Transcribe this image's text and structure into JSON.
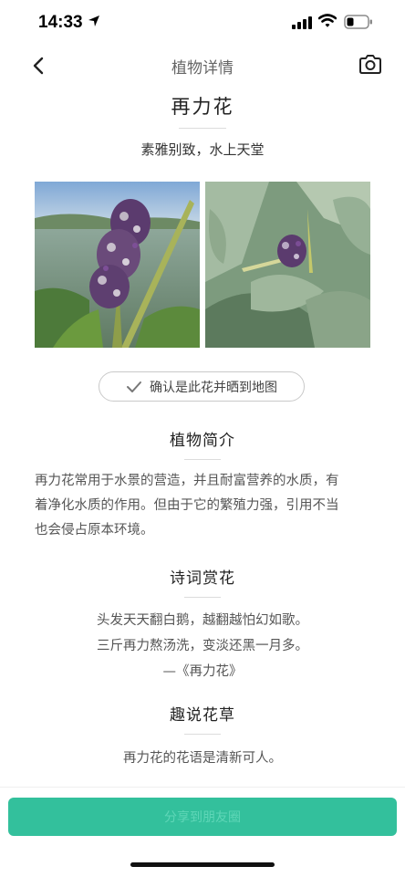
{
  "status_bar": {
    "time": "14:33",
    "icons": [
      "location-arrow-icon",
      "cellular-signal-icon",
      "wifi-icon",
      "battery-icon"
    ]
  },
  "nav": {
    "title": "植物详情",
    "back_icon": "chevron-left-icon",
    "camera_icon": "camera-icon"
  },
  "plant": {
    "name": "再力花",
    "slogan": "素雅别致，水上天堂",
    "photos": [
      "plant-photo-closeup",
      "plant-photo-leaves"
    ]
  },
  "confirm_button": {
    "label": "确认是此花并晒到地图",
    "icon": "checkmark-icon"
  },
  "intro": {
    "title": "植物简介",
    "lines": [
      "再力花常用于水景的营造，并且耐富营养的水质，有",
      "着净化水质的作用。但由于它的繁殖力强，引用不当",
      "也会侵占原本环境。"
    ]
  },
  "poem": {
    "title": "诗词赏花",
    "lines": [
      "头发天天翻白鹅，越翻越怕幻如歌。",
      "三斤再力熬汤洗，变淡还黑一月多。",
      "—《再力花》"
    ]
  },
  "fun": {
    "title": "趣说花草",
    "text": "再力花的花语是清新可人。"
  },
  "share_button": {
    "label": "分享到朋友圈"
  },
  "colors": {
    "accent": "#33c09c",
    "text_primary": "#222222",
    "text_secondary": "#555555"
  }
}
